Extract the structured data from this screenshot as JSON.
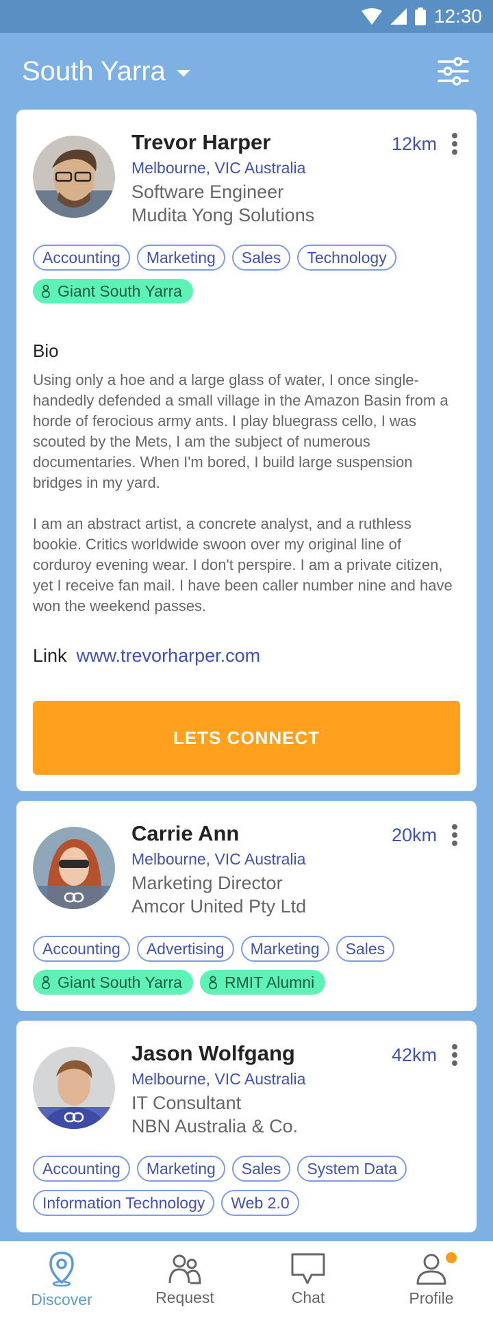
{
  "status_bar": {
    "time": "12:30"
  },
  "header": {
    "location": "South Yarra"
  },
  "cards": [
    {
      "name": "Trevor Harper",
      "distance": "12km",
      "location": "Melbourne, VIC Australia",
      "role": "Software Engineer",
      "company": "Mudita Yong Solutions",
      "tags": [
        "Accounting",
        "Marketing",
        "Sales",
        "Technology"
      ],
      "groups": [
        "Giant South Yarra"
      ],
      "bio_title": "Bio",
      "bio": [
        "Using only a hoe and a large glass of water, I once single-handedly defended a small village in the Amazon Basin from a horde of ferocious army ants. I play bluegrass cello, I was scouted by the Mets, I am the subject of numerous documentaries. When I'm bored, I build large suspension bridges in my yard.",
        "I am an abstract artist, a concrete analyst, and a ruthless bookie. Critics worldwide swoon over my original line of corduroy evening wear. I don't perspire. I am a private citizen, yet I receive fan mail. I have been caller number nine and have won the weekend passes."
      ],
      "link_label": "Link",
      "link_url": "www.trevorharper.com",
      "cta": "LETS CONNECT"
    },
    {
      "name": "Carrie Ann",
      "distance": "20km",
      "location": "Melbourne, VIC Australia",
      "role": "Marketing Director",
      "company": "Amcor United Pty Ltd",
      "tags": [
        "Accounting",
        "Advertising",
        "Marketing",
        "Sales"
      ],
      "groups": [
        "Giant South Yarra",
        "RMIT Alumni"
      ]
    },
    {
      "name": "Jason Wolfgang",
      "distance": "42km",
      "location": "Melbourne, VIC Australia",
      "role": "IT Consultant",
      "company": "NBN Australia & Co.",
      "tags": [
        "Accounting",
        "Marketing",
        "Sales",
        "System Data",
        "Information Technology",
        "Web 2.0"
      ],
      "groups": []
    }
  ],
  "nav": {
    "discover": "Discover",
    "request": "Request",
    "chat": "Chat",
    "profile": "Profile"
  },
  "colors": {
    "primary": "#7eb0e4",
    "accent": "#ffa11f",
    "link": "#3f51b5",
    "group": "#5ef2b6"
  }
}
